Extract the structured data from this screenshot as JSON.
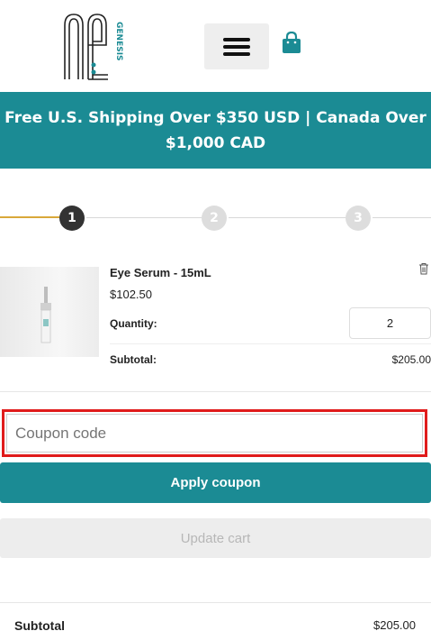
{
  "header": {
    "logo_text": "neo",
    "logo_sub": "GENESIS",
    "menu_icon": "hamburger-menu-icon",
    "cart_icon": "shopping-bag-icon"
  },
  "banner": {
    "text": "Free U.S. Shipping Over $350 USD | Canada Over $1,000 CAD"
  },
  "steps": {
    "items": [
      {
        "label": "1",
        "state": "active"
      },
      {
        "label": "2",
        "state": "inactive"
      },
      {
        "label": "3",
        "state": "inactive"
      }
    ]
  },
  "cart_item": {
    "name": "Eye Serum - 15mL",
    "price": "$102.50",
    "quantity_label": "Quantity:",
    "quantity": "2",
    "subtotal_label": "Subtotal:",
    "subtotal": "$205.00",
    "remove_icon": "trash-icon"
  },
  "coupon": {
    "placeholder": "Coupon code",
    "apply_label": "Apply coupon",
    "update_label": "Update cart"
  },
  "totals": {
    "subtotal_label": "Subtotal",
    "subtotal_value": "$205.00"
  },
  "colors": {
    "brand_teal": "#1b8b94",
    "step_active": "#333333",
    "step_inactive": "#dddddd",
    "progress_gold": "#d9a83a",
    "highlight_red": "#e01b1b"
  }
}
